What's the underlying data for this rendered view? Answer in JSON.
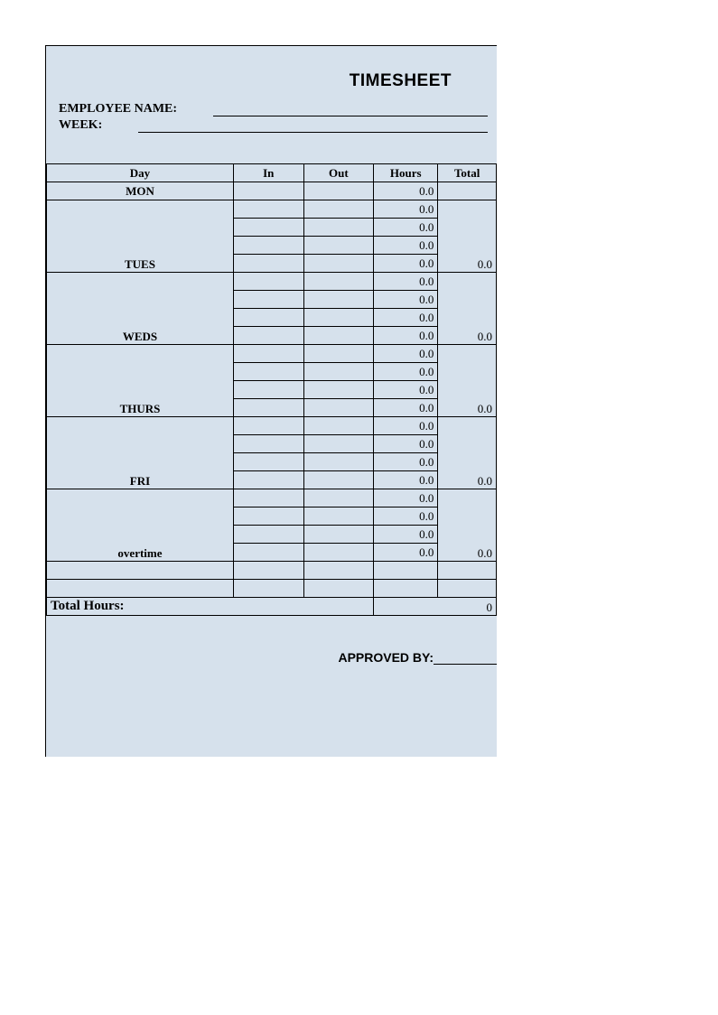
{
  "title": "TIMESHEET",
  "fields": {
    "employee_name_label": "EMPLOYEE NAME:",
    "week_label": "WEEK:"
  },
  "columns": {
    "day": "Day",
    "in": "In",
    "out": "Out",
    "hours": "Hours",
    "total": "Total"
  },
  "groups": [
    {
      "label": "MON",
      "rows": 1,
      "hours": [
        "0.0"
      ],
      "total": ""
    },
    {
      "label": "TUES",
      "rows": 4,
      "hours": [
        "0.0",
        "0.0",
        "0.0",
        "0.0"
      ],
      "total": "0.0"
    },
    {
      "label": "WEDS",
      "rows": 4,
      "hours": [
        "0.0",
        "0.0",
        "0.0",
        "0.0"
      ],
      "total": "0.0"
    },
    {
      "label": "THURS",
      "rows": 4,
      "hours": [
        "0.0",
        "0.0",
        "0.0",
        "0.0"
      ],
      "total": "0.0"
    },
    {
      "label": "FRI",
      "rows": 4,
      "hours": [
        "0.0",
        "0.0",
        "0.0",
        "0.0"
      ],
      "total": "0.0"
    },
    {
      "label": "overtime",
      "rows": 4,
      "hours": [
        "0.0",
        "0.0",
        "0.0",
        "0.0"
      ],
      "total": "0.0"
    }
  ],
  "blank_rows": 2,
  "totals": {
    "label": "Total Hours:",
    "value": "0"
  },
  "approved_label": "APPROVED BY:"
}
